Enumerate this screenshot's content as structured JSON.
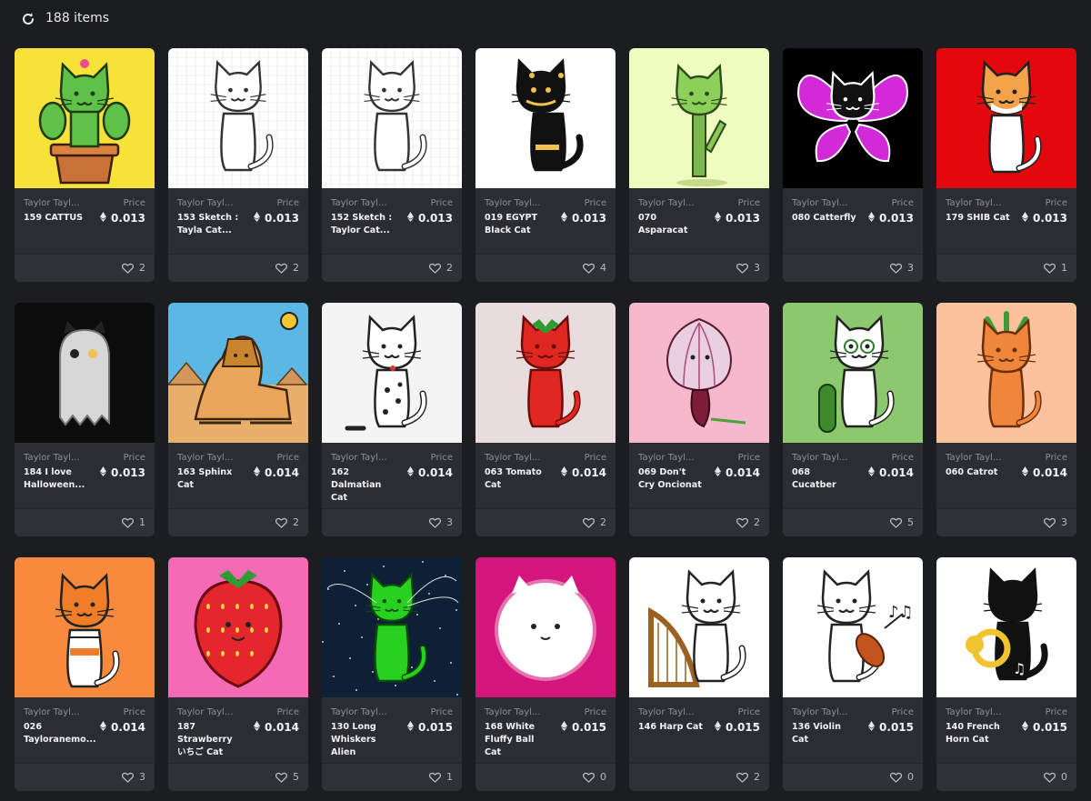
{
  "toolbar": {
    "refresh_icon": "refresh-icon",
    "item_count": "188 items"
  },
  "colors": {
    "background": "#1c1d21",
    "card": "#2b2d33",
    "footer": "#2f3137",
    "muted": "#8c8f96"
  },
  "cards": [
    {
      "creator": "Taylor Tayl...",
      "name": "159 CATTUS",
      "price_label": "Price",
      "price": "0.013",
      "likes": "2",
      "art": "cactus",
      "bg": "#f7e23a"
    },
    {
      "creator": "Taylor Tayl...",
      "name": "153 Sketch : Tayla Cat...",
      "price_label": "Price",
      "price": "0.013",
      "likes": "2",
      "art": "sketch",
      "bg": "#ffffff"
    },
    {
      "creator": "Taylor Tayl...",
      "name": "152 Sketch : Taylor Cat...",
      "price_label": "Price",
      "price": "0.013",
      "likes": "2",
      "art": "sketch2",
      "bg": "#ffffff"
    },
    {
      "creator": "Taylor Tayl...",
      "name": "019 EGYPT Black Cat",
      "price_label": "Price",
      "price": "0.013",
      "likes": "4",
      "art": "egypt",
      "bg": "#ffffff"
    },
    {
      "creator": "Taylor Tayl...",
      "name": "070 Asparacat",
      "price_label": "Price",
      "price": "0.013",
      "likes": "3",
      "art": "aspara",
      "bg": "#eefcbf"
    },
    {
      "creator": "Taylor Tayl...",
      "name": "080 Catterfly",
      "price_label": "Price",
      "price": "0.013",
      "likes": "3",
      "art": "catterfly",
      "bg": "#000000"
    },
    {
      "creator": "Taylor Tayl...",
      "name": "179 SHIB Cat",
      "price_label": "Price",
      "price": "0.013",
      "likes": "1",
      "art": "shib",
      "bg": "#e3080b"
    },
    {
      "creator": "Taylor Tayl...",
      "name": "184 I love Halloween...",
      "price_label": "Price",
      "price": "0.013",
      "likes": "1",
      "art": "ghost",
      "bg": "#0c0c0c"
    },
    {
      "creator": "Taylor Tayl...",
      "name": "163 Sphinx Cat",
      "price_label": "Price",
      "price": "0.014",
      "likes": "2",
      "art": "sphinx",
      "bg": "#5bb7e3"
    },
    {
      "creator": "Taylor Tayl...",
      "name": "162 Dalmatian Cat",
      "price_label": "Price",
      "price": "0.014",
      "likes": "3",
      "art": "dalmatian",
      "bg": "#f4f4f4"
    },
    {
      "creator": "Taylor Tayl...",
      "name": "063 Tomato Cat",
      "price_label": "Price",
      "price": "0.014",
      "likes": "2",
      "art": "tomato",
      "bg": "#e8dcdc"
    },
    {
      "creator": "Taylor Tayl...",
      "name": "069 Don't Cry Oncionat",
      "price_label": "Price",
      "price": "0.014",
      "likes": "2",
      "art": "onion",
      "bg": "#f5b8cc"
    },
    {
      "creator": "Taylor Tayl...",
      "name": "068 Cucatber",
      "price_label": "Price",
      "price": "0.014",
      "likes": "5",
      "art": "cucumber",
      "bg": "#8cc96e"
    },
    {
      "creator": "Taylor Tayl...",
      "name": "060 Catrot",
      "price_label": "Price",
      "price": "0.014",
      "likes": "3",
      "art": "carrot",
      "bg": "#fbc39b"
    },
    {
      "creator": "Taylor Tayl...",
      "name": "026 Tayloranemo...",
      "price_label": "Price",
      "price": "0.014",
      "likes": "3",
      "art": "nemo",
      "bg": "#f78a3c"
    },
    {
      "creator": "Taylor Tayl...",
      "name": "187 Strawberry いちご Cat",
      "price_label": "Price",
      "price": "0.014",
      "likes": "5",
      "art": "strawberry",
      "bg": "#f56ab4"
    },
    {
      "creator": "Taylor Tayl...",
      "name": "130 Long Whiskers Alien",
      "price_label": "Price",
      "price": "0.015",
      "likes": "1",
      "art": "alien",
      "bg": "#0e2036"
    },
    {
      "creator": "Taylor Tayl...",
      "name": "168 White Fluffy Ball Cat",
      "price_label": "Price",
      "price": "0.015",
      "likes": "0",
      "art": "fluffy",
      "bg": "#d4157b"
    },
    {
      "creator": "Taylor Tayl...",
      "name": "146 Harp Cat",
      "price_label": "Price",
      "price": "0.015",
      "likes": "2",
      "art": "harp",
      "bg": "#ffffff"
    },
    {
      "creator": "Taylor Tayl...",
      "name": "136 Violin Cat",
      "price_label": "Price",
      "price": "0.015",
      "likes": "0",
      "art": "violin",
      "bg": "#ffffff"
    },
    {
      "creator": "Taylor Tayl...",
      "name": "140 French Horn Cat",
      "price_label": "Price",
      "price": "0.015",
      "likes": "0",
      "art": "horn",
      "bg": "#ffffff"
    }
  ]
}
